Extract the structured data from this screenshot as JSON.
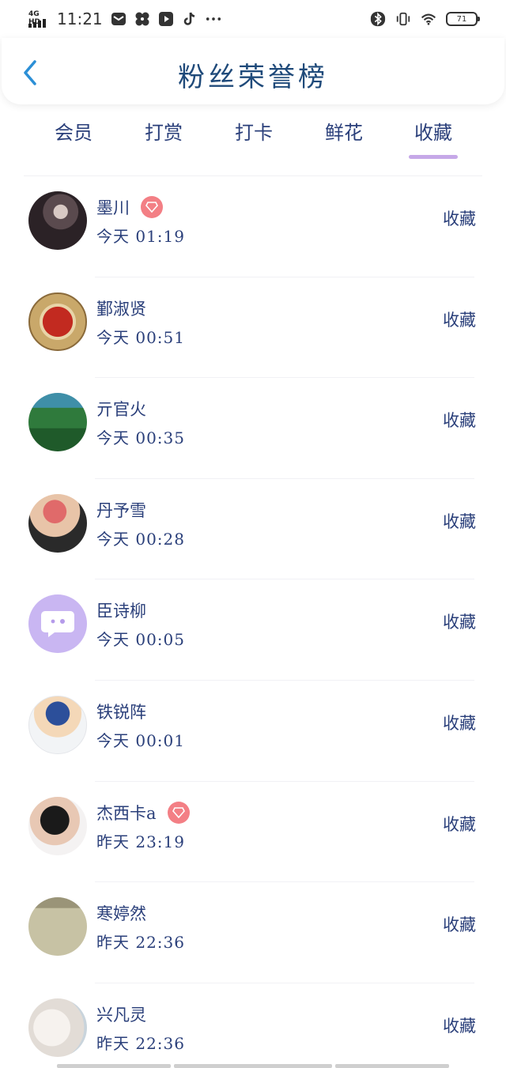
{
  "status_bar": {
    "network": "4G HD",
    "time": "11:21",
    "battery": "71"
  },
  "header": {
    "title": "粉丝荣誉榜"
  },
  "tabs": [
    {
      "label": "会员"
    },
    {
      "label": "打赏"
    },
    {
      "label": "打卡"
    },
    {
      "label": "鲜花"
    },
    {
      "label": "收藏"
    }
  ],
  "active_tab": "收藏",
  "list": [
    {
      "name": "墨川",
      "time": "今天 01:19",
      "action": "收藏",
      "vip": true
    },
    {
      "name": "鄞淑贤",
      "time": "今天 00:51",
      "action": "收藏",
      "vip": false
    },
    {
      "name": "亓官火",
      "time": "今天 00:35",
      "action": "收藏",
      "vip": false
    },
    {
      "name": "丹予雪",
      "time": "今天 00:28",
      "action": "收藏",
      "vip": false
    },
    {
      "name": "臣诗柳",
      "time": "今天 00:05",
      "action": "收藏",
      "vip": false
    },
    {
      "name": "铁锐阵",
      "time": "今天 00:01",
      "action": "收藏",
      "vip": false
    },
    {
      "name": "杰西卡a",
      "time": "昨天 23:19",
      "action": "收藏",
      "vip": true
    },
    {
      "name": "寒婷然",
      "time": "昨天 22:36",
      "action": "收藏",
      "vip": false
    },
    {
      "name": "兴凡灵",
      "time": "昨天 22:36",
      "action": "收藏",
      "vip": false
    }
  ],
  "colors": {
    "accent_underline": "#c6a8e8",
    "vip_badge": "#f37f85",
    "text": "#2a3f7a",
    "back_arrow": "#2b8fd6"
  }
}
